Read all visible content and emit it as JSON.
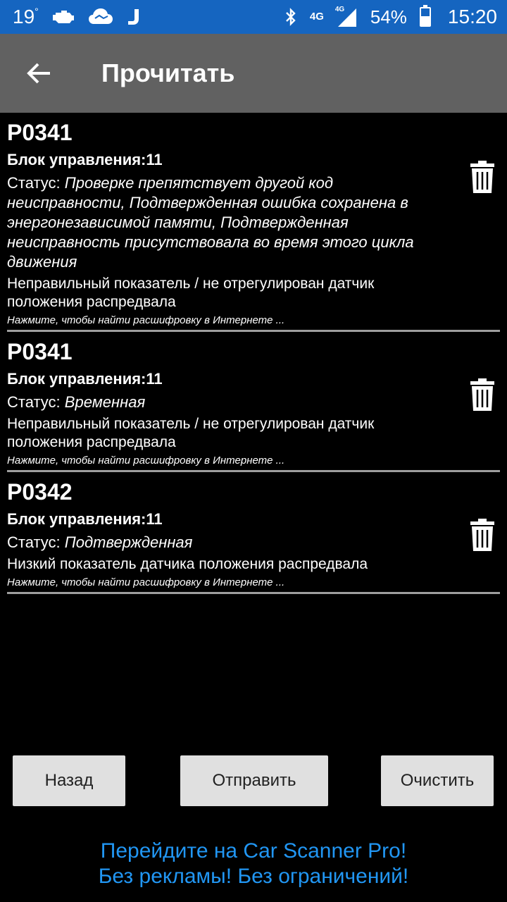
{
  "status_bar": {
    "temperature": "19",
    "degree": "°",
    "network": "4G",
    "network2": "4G",
    "battery_percent": "54%",
    "battery_level": 0.54,
    "time": "15:20",
    "icons": [
      "engine-icon",
      "cloud-icon",
      "j-icon",
      "bluetooth-icon",
      "signal-icon",
      "battery-icon"
    ]
  },
  "toolbar": {
    "title": "Прочитать",
    "back_icon": "arrow-left-icon"
  },
  "dtc_list": [
    {
      "code": "P0341",
      "block": "Блок управления:11",
      "status_label": "Статус:",
      "status_value": "Проверке препятствует другой код неисправности, Подтвержденная ошибка сохранена в энергонезависимой памяти, Подтвержденная неисправность присутствовала во время этого цикла движения",
      "description": "Неправильный показатель / не отрегулирован датчик положения распредвала",
      "link": "Нажмите, чтобы найти расшифровку в Интернете ..."
    },
    {
      "code": "P0341",
      "block": "Блок управления:11",
      "status_label": "Статус:",
      "status_value": "Временная",
      "description": "Неправильный показатель / не отрегулирован датчик положения распредвала",
      "link": "Нажмите, чтобы найти расшифровку в Интернете ..."
    },
    {
      "code": "P0342",
      "block": "Блок управления:11",
      "status_label": "Статус:",
      "status_value": "Подтвержденная",
      "description": "Низкий показатель датчика положения распредвала",
      "link": "Нажмите, чтобы найти расшифровку в Интернете ..."
    }
  ],
  "buttons": {
    "back": "Назад",
    "send": "Отправить",
    "clear": "Очистить"
  },
  "promo": {
    "line1": "Перейдите на Car Scanner Pro!",
    "line2": "Без рекламы! Без ограничений!"
  },
  "colors": {
    "status_bar": "#1565c0",
    "toolbar": "#616161",
    "promo": "#2196f3",
    "button_bg": "#e0e0e0"
  }
}
